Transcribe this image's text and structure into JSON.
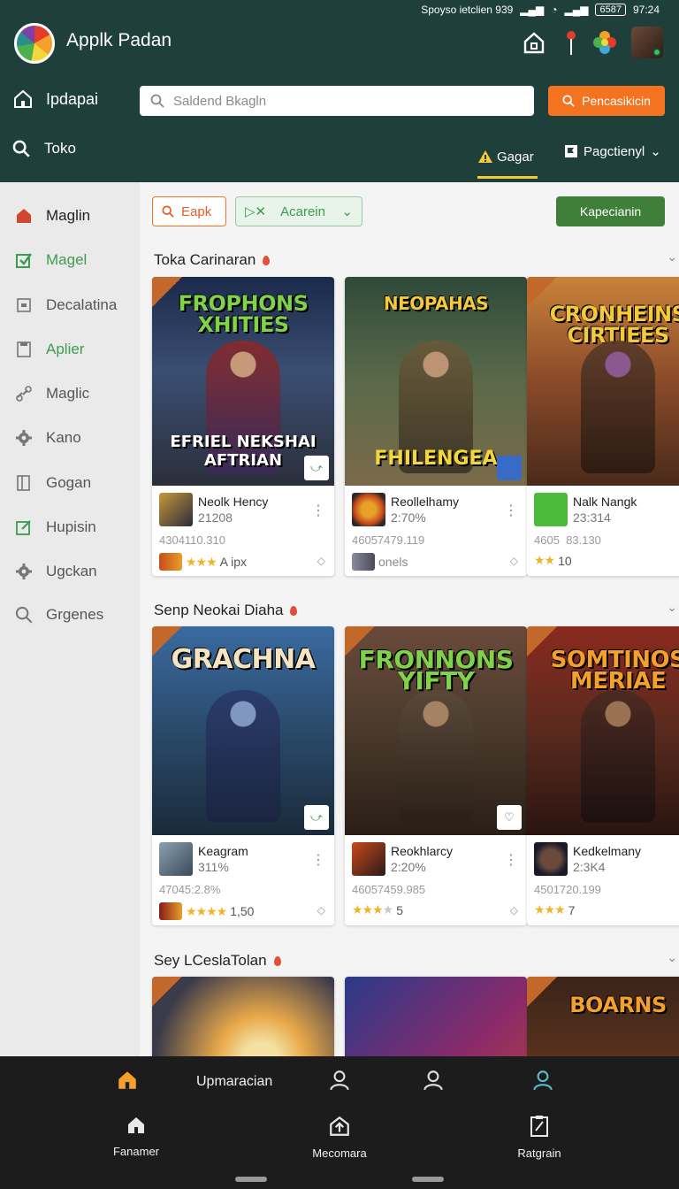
{
  "status_bar": {
    "text": "Spoyso ietclien 939",
    "battery": "6587",
    "time": "97:24"
  },
  "header": {
    "app_title": "Applk Padan",
    "icons": [
      "home-outline-icon",
      "pin-icon",
      "flower-icon",
      "avatar"
    ]
  },
  "row2": {
    "home_label": "Ipdapai",
    "search_placeholder": "Saldend Bkagln",
    "cta_label": "Pencasikicin"
  },
  "row3": {
    "search_label": "Toko",
    "tab_active": "Gagar",
    "tab_dropdown": "Pagctienyl"
  },
  "sidebar": {
    "items": [
      {
        "label": "Maglin",
        "icon": "home-icon"
      },
      {
        "label": "Magel",
        "icon": "checkbox-icon"
      },
      {
        "label": "Decalatina",
        "icon": "square-icon"
      },
      {
        "label": "Aplier",
        "icon": "document-icon"
      },
      {
        "label": "Maglic",
        "icon": "link-icon"
      },
      {
        "label": "Kano",
        "icon": "gear-icon"
      },
      {
        "label": "Gogan",
        "icon": "file-icon"
      },
      {
        "label": "Hupisin",
        "icon": "edit-icon"
      },
      {
        "label": "Ugckan",
        "icon": "gear-icon"
      },
      {
        "label": "Grgenes",
        "icon": "search-icon"
      }
    ]
  },
  "filters": {
    "chip1": "Eapk",
    "chip2": "Acarein",
    "action_button": "Kapecianin"
  },
  "sections": [
    {
      "title": "Toka Carinaran",
      "cards": [
        {
          "art_title": "FROPHONS XHITIES",
          "art_sub": "EFRIEL NEKSHAI AFTRIAN",
          "name": "Neolk Hency",
          "num": "21208",
          "meta": "4304110.310",
          "rating_text": "A ipx",
          "stars": 3,
          "accent": "#2a3d6a"
        },
        {
          "art_title": "NEOPAHAS",
          "art_sub": "FHILENGEA",
          "name": "Reollelhamy",
          "num": "2:70%",
          "meta": "46057479.119",
          "rating_text": "onels",
          "stars": 0,
          "accent": "#3e4a3a"
        },
        {
          "art_title": "CRONHEINS CIRTIEES",
          "art_sub": "",
          "name": "Nalk Nangk",
          "num": "23:314",
          "meta": "4605  83.130",
          "rating_text": "10",
          "stars": 2,
          "accent": "#6a4a2a"
        }
      ]
    },
    {
      "title": "Senp Neokai Diaha",
      "cards": [
        {
          "art_title": "GRACHNA",
          "art_sub": "",
          "name": "Keagram",
          "num": "311%",
          "meta": "47045:2.8%",
          "rating_text": "1,50",
          "stars": 4,
          "accent": "#2d4a6b"
        },
        {
          "art_title": "FRONNONS YIFTY",
          "art_sub": "",
          "name": "Reokhlarcy",
          "num": "2:20%",
          "meta": "46057459.985",
          "rating_text": "5",
          "stars": 3,
          "accent": "#4a3a2c"
        },
        {
          "art_title": "SOMTINOS MERIAE",
          "art_sub": "",
          "name": "Kedkelmany",
          "num": "2:3K4",
          "meta": "4501720.199",
          "rating_text": "7",
          "stars": 3,
          "accent": "#5a2a1e"
        }
      ]
    },
    {
      "title": "Sey LCeslaTolan",
      "cards": [
        {
          "art_title": "",
          "accent": "#d88a32"
        },
        {
          "art_title": "",
          "accent": "#4a2a7a"
        },
        {
          "art_title": "BOARNS",
          "accent": "#3a2418"
        }
      ]
    }
  ],
  "bottom_nav": {
    "top_label": "Upmaracian",
    "items": [
      {
        "label": "Fanamer",
        "icon": "home-icon"
      },
      {
        "label": "Mecomara",
        "icon": "upload-box-icon"
      },
      {
        "label": "Ratgrain",
        "icon": "clipboard-icon"
      }
    ]
  },
  "colors": {
    "header_bg": "#1f3f3b",
    "accent_orange": "#f47320",
    "accent_green": "#3f7f3a",
    "sidebar_bg": "#eaeaea",
    "nav_bg": "#1c1c1c"
  }
}
